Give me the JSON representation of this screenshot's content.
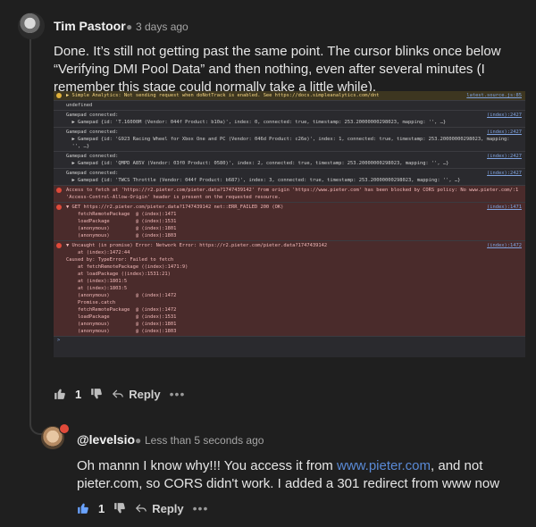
{
  "comment1": {
    "author": "Tim Pastoor",
    "time": "3 days ago",
    "text": "Done. It’s still not getting past the same point. The cursor blinks once below “Verifying DMI Pool Data” and then nothing, even after several minutes (I remember this stage could normally take a little while).",
    "likes": "1",
    "reply_label": "Reply",
    "more_label": "•••"
  },
  "console": {
    "rows": [
      {
        "type": "warn",
        "text": "▶ Simple Analytics: Not sending request when doNotTrack is enabled. See https://docs.simpleanalytics.com/dnt",
        "src": "latest.source.js:85"
      },
      {
        "type": "plain",
        "text": "undefined",
        "src": ""
      },
      {
        "type": "plain",
        "text": "Gamepad connected:\n  ▶ Gamepad {id: 'T.16000M (Vendor: 044f Product: b10a)', index: 0, connected: true, timestamp: 253.20000000298023, mapping: '', …}",
        "src": "(index):2427"
      },
      {
        "type": "plain",
        "text": "Gamepad connected:\n  ▶ Gamepad {id: 'G923 Racing Wheel for Xbox One and PC (Vendor: 046d Product: c26e)', index: 1, connected: true, timestamp: 253.20000000298023, mapping:\n  '', …}",
        "src": "(index):2427"
      },
      {
        "type": "plain",
        "text": "Gamepad connected:\n  ▶ Gamepad {id: 'QMPD A85V (Vendor: 03f0 Product: 0580)', index: 2, connected: true, timestamp: 253.20000000298023, mapping: '', …}",
        "src": "(index):2427"
      },
      {
        "type": "plain",
        "text": "Gamepad connected:\n  ▶ Gamepad {id: 'TWCS Throttle (Vendor: 044f Product: b687)', index: 3, connected: true, timestamp: 253.20000000298023, mapping: '', …}",
        "src": "(index):2427"
      },
      {
        "type": "err",
        "text": "Access to fetch at 'https://r2.pieter.com/pieter.data?1747439142' from origin 'https://www.pieter.com' has been blocked by CORS policy: No www.pieter.com/:1\n'Access-Control-Allow-Origin' header is present on the requested resource.",
        "src": ""
      },
      {
        "type": "err",
        "text": "▼ GET https://r2.pieter.com/pieter.data?1747439142 net::ERR_FAILED 200 (OK)\n    fetchRemotePackage  @ (index):1471\n    loadPackage         @ (index):1531\n    (anonymous)         @ (index):1801\n    (anonymous)         @ (index):1803",
        "src": "(index):1471"
      },
      {
        "type": "err",
        "text": "▼ Uncaught (in promise) Error: Network Error: https://r2.pieter.com/pieter.data?1747439142\n    at (index):1472:44\nCaused by: TypeError: Failed to fetch\n    at fetchRemotePackage ((index):1471:9)\n    at loadPackage ((index):1531:21)\n    at (index):1801:5\n    at (index):1803:5\n    (anonymous)         @ (index):1472\n    Promise.catch\n    fetchRemotePackage  @ (index):1472\n    loadPackage         @ (index):1531\n    (anonymous)         @ (index):1801\n    (anonymous)         @ (index):1803",
        "src": "(index):1472"
      }
    ],
    "prompt": ">"
  },
  "comment2": {
    "author": "@levelsio",
    "time": "Less than 5 seconds ago",
    "text_before": "Oh mannn I know why!!! You access it from ",
    "link": "www.pieter.com",
    "text_after": ", and not pieter.com, so CORS didn't work. I added a 301 redirect from www now",
    "likes": "1",
    "reply_label": "Reply",
    "more_label": "•••"
  },
  "colors": {
    "accent": "#5a8ad6",
    "error_bg": "#4a2b2b",
    "warn_bg": "#3d3620"
  }
}
